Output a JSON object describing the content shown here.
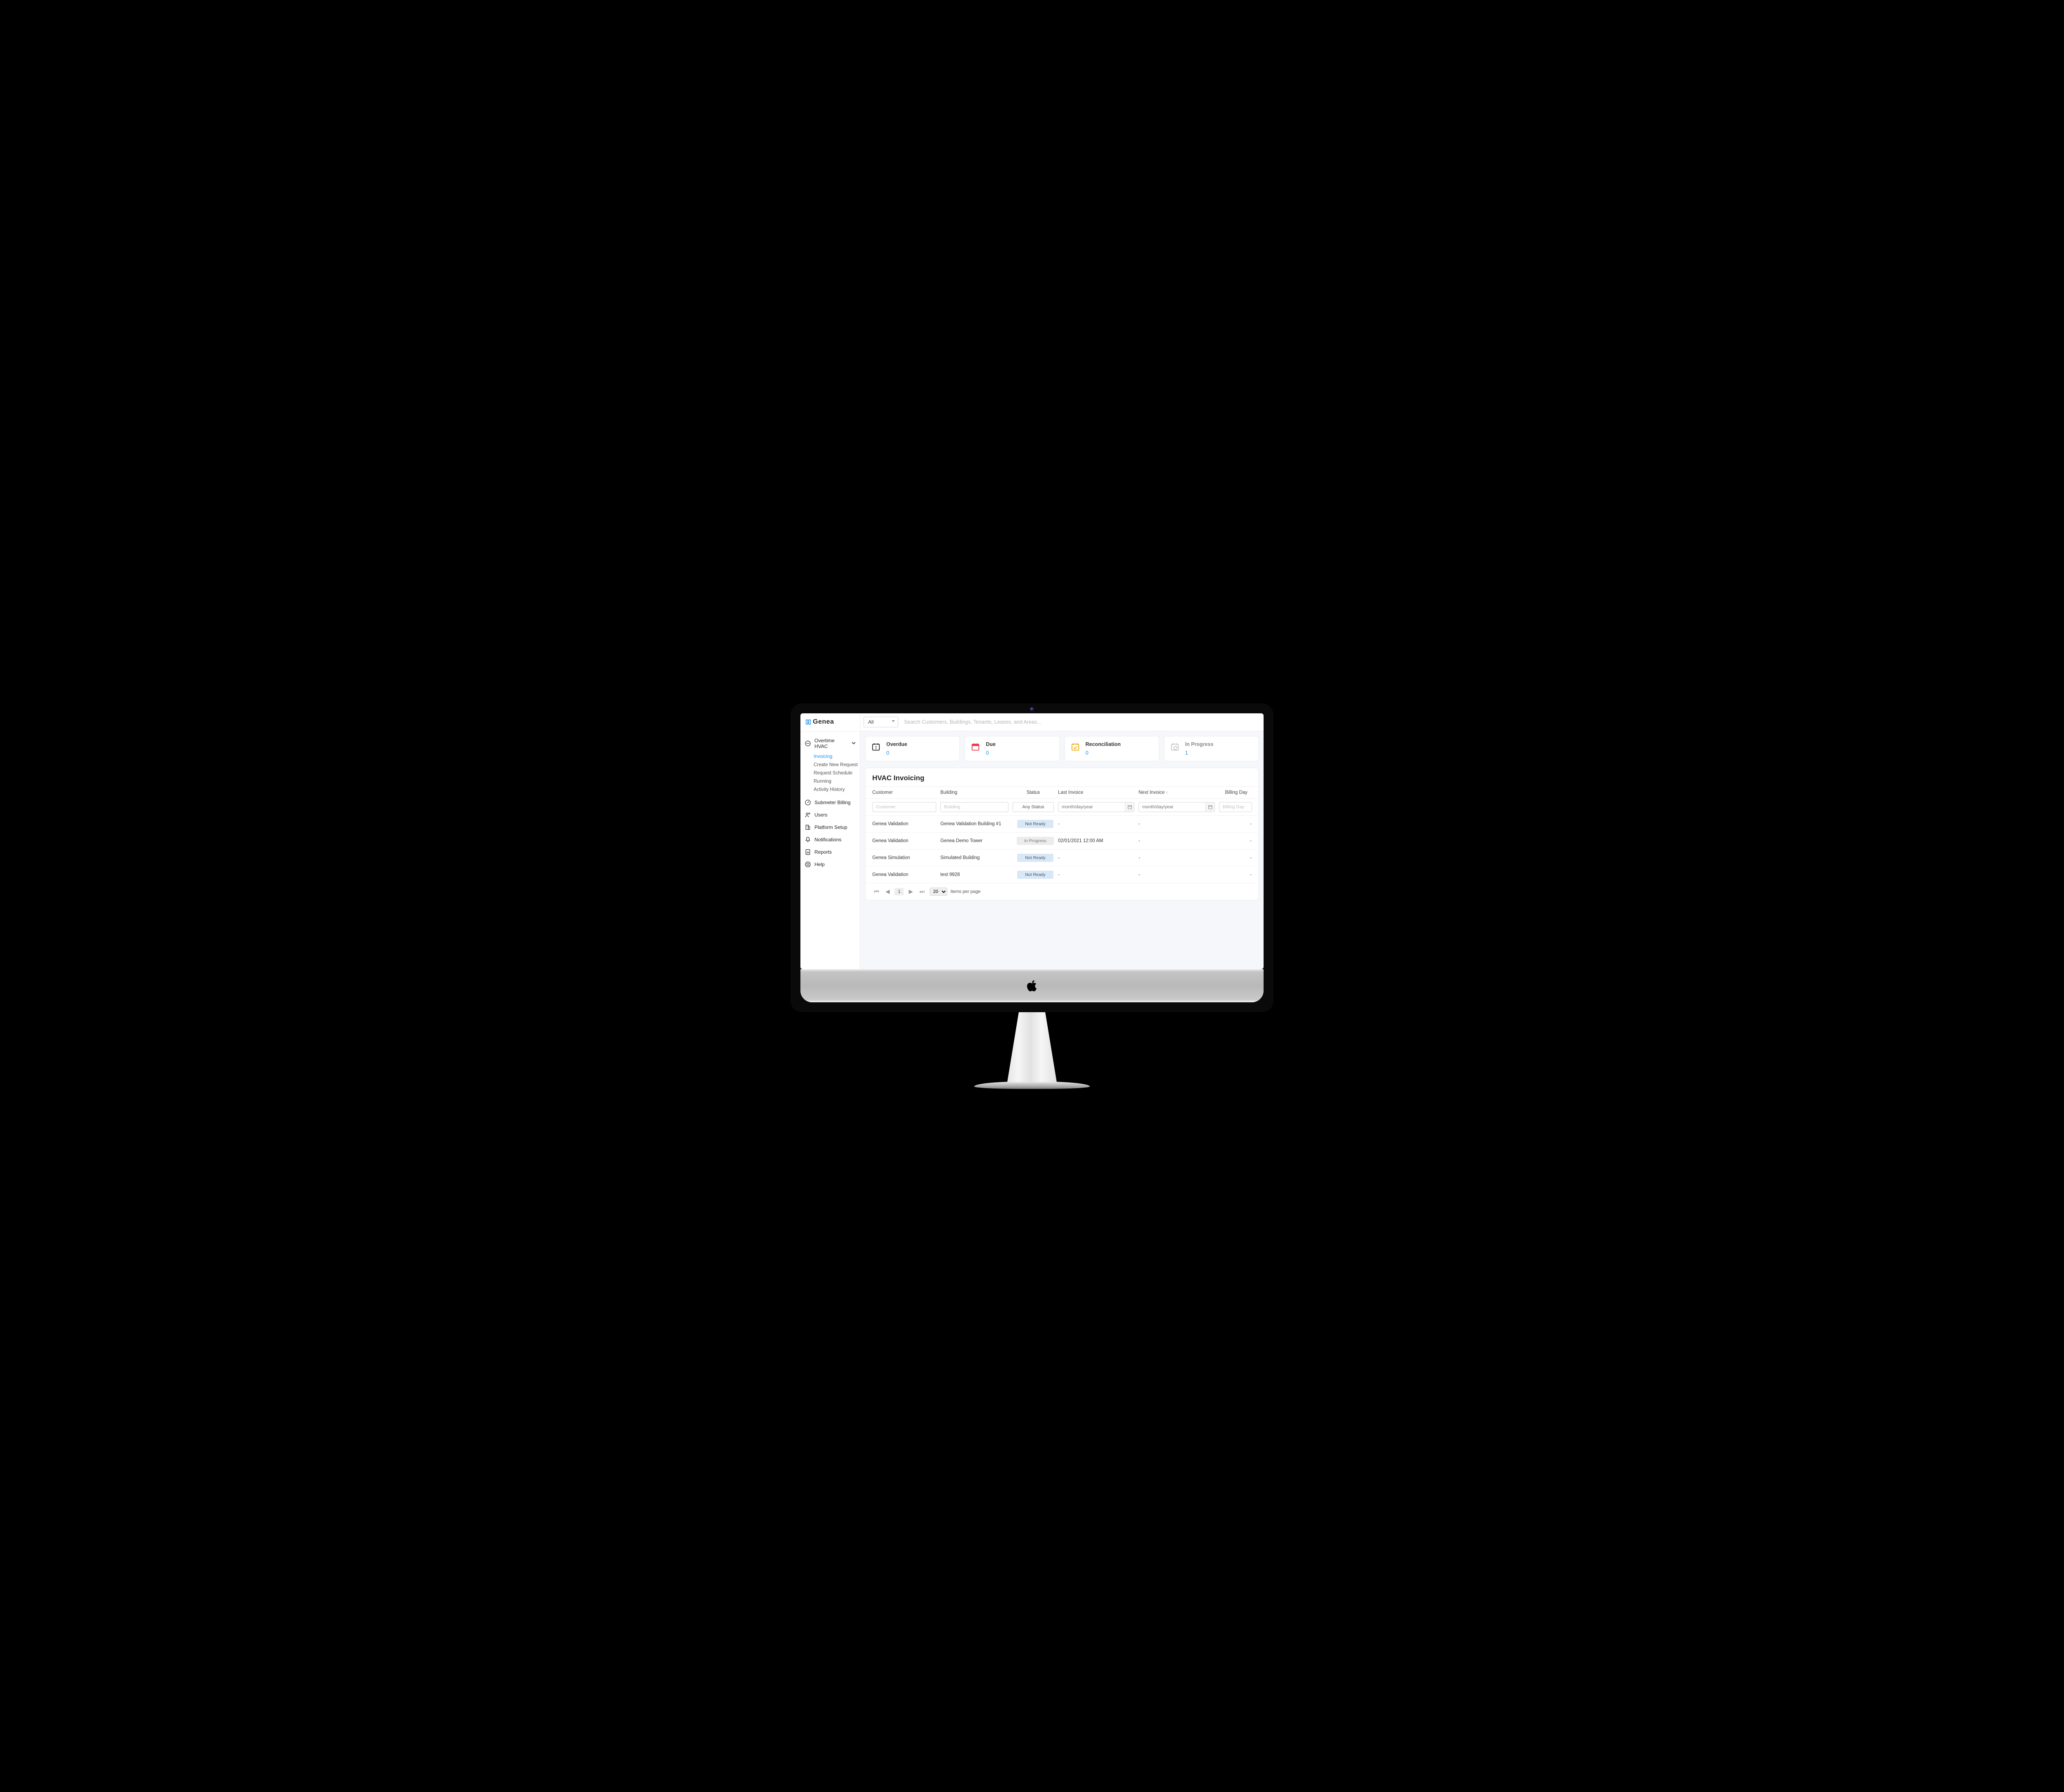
{
  "brand": {
    "name": "Genea"
  },
  "sidebar": {
    "primary_label": "Overtime HVAC",
    "subitems": [
      {
        "label": "Invoicing",
        "active": true
      },
      {
        "label": "Create New Request"
      },
      {
        "label": "Request Schedule"
      },
      {
        "label": "Running"
      },
      {
        "label": "Activity History"
      }
    ],
    "items": [
      {
        "label": "Submeter Billing"
      },
      {
        "label": "Users"
      },
      {
        "label": "Platform Setup"
      },
      {
        "label": "Notifications"
      },
      {
        "label": "Reports"
      },
      {
        "label": "Help"
      }
    ]
  },
  "topbar": {
    "filter_value": "All",
    "search_placeholder": "Search Customers, Buildings, Tenants, Leases, and Areas..."
  },
  "cards": [
    {
      "title": "Overdue",
      "value": "0",
      "icon": "calendar-alert",
      "color": "#2a2a2a"
    },
    {
      "title": "Due",
      "value": "0",
      "icon": "calendar-due",
      "color": "#e63946"
    },
    {
      "title": "Reconciliation",
      "value": "0",
      "icon": "calendar-check",
      "color": "#f0a500"
    },
    {
      "title": "In Progress",
      "value": "1",
      "icon": "calendar-progress",
      "color": "#b8b8b8",
      "muted": true
    }
  ],
  "panel": {
    "title": "HVAC Invoicing",
    "columns": {
      "customer": "Customer",
      "building": "Building",
      "status": "Status",
      "last": "Last Invoice",
      "next": "Next Invoice",
      "bill": "Billing Day"
    },
    "filters": {
      "customer_ph": "Customer",
      "building_ph": "Building",
      "status_value": "Any Status",
      "last_ph": "month/day/year",
      "next_ph": "month/day/year",
      "bill_ph": "Billing Day"
    },
    "rows": [
      {
        "customer": "Genea Validation",
        "building": "Genea Validation Building #1",
        "status": "Not Ready",
        "status_kind": "notready",
        "last": "-",
        "next": "-",
        "bill": "-"
      },
      {
        "customer": "Genea Validation",
        "building": "Genea Demo Tower",
        "status": "In Progress",
        "status_kind": "progress",
        "last": "02/01/2021 12:00 AM",
        "next": "-",
        "bill": "-"
      },
      {
        "customer": "Genea Simulation",
        "building": "Simulated Building",
        "status": "Not Ready",
        "status_kind": "notready",
        "last": "-",
        "next": "-",
        "bill": "-"
      },
      {
        "customer": "Genea Validation",
        "building": "test 9928",
        "status": "Not Ready",
        "status_kind": "notready",
        "last": "-",
        "next": "-",
        "bill": "-"
      }
    ],
    "pager": {
      "page": "1",
      "page_size": "20",
      "label": "items per page"
    }
  }
}
